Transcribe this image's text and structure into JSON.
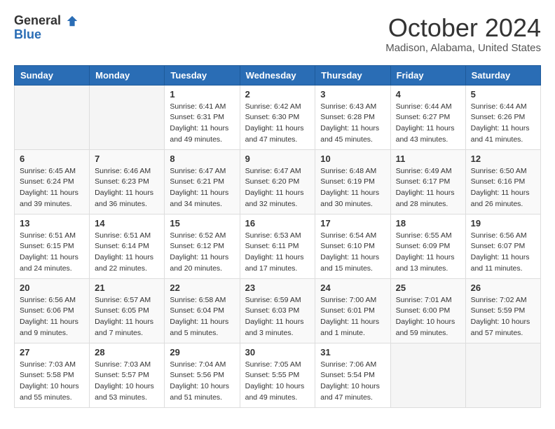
{
  "logo": {
    "general": "General",
    "blue": "Blue"
  },
  "title": "October 2024",
  "subtitle": "Madison, Alabama, United States",
  "days_of_week": [
    "Sunday",
    "Monday",
    "Tuesday",
    "Wednesday",
    "Thursday",
    "Friday",
    "Saturday"
  ],
  "weeks": [
    [
      {
        "day": "",
        "sunrise": "",
        "sunset": "",
        "daylight": ""
      },
      {
        "day": "",
        "sunrise": "",
        "sunset": "",
        "daylight": ""
      },
      {
        "day": "1",
        "sunrise": "Sunrise: 6:41 AM",
        "sunset": "Sunset: 6:31 PM",
        "daylight": "Daylight: 11 hours and 49 minutes."
      },
      {
        "day": "2",
        "sunrise": "Sunrise: 6:42 AM",
        "sunset": "Sunset: 6:30 PM",
        "daylight": "Daylight: 11 hours and 47 minutes."
      },
      {
        "day": "3",
        "sunrise": "Sunrise: 6:43 AM",
        "sunset": "Sunset: 6:28 PM",
        "daylight": "Daylight: 11 hours and 45 minutes."
      },
      {
        "day": "4",
        "sunrise": "Sunrise: 6:44 AM",
        "sunset": "Sunset: 6:27 PM",
        "daylight": "Daylight: 11 hours and 43 minutes."
      },
      {
        "day": "5",
        "sunrise": "Sunrise: 6:44 AM",
        "sunset": "Sunset: 6:26 PM",
        "daylight": "Daylight: 11 hours and 41 minutes."
      }
    ],
    [
      {
        "day": "6",
        "sunrise": "Sunrise: 6:45 AM",
        "sunset": "Sunset: 6:24 PM",
        "daylight": "Daylight: 11 hours and 39 minutes."
      },
      {
        "day": "7",
        "sunrise": "Sunrise: 6:46 AM",
        "sunset": "Sunset: 6:23 PM",
        "daylight": "Daylight: 11 hours and 36 minutes."
      },
      {
        "day": "8",
        "sunrise": "Sunrise: 6:47 AM",
        "sunset": "Sunset: 6:21 PM",
        "daylight": "Daylight: 11 hours and 34 minutes."
      },
      {
        "day": "9",
        "sunrise": "Sunrise: 6:47 AM",
        "sunset": "Sunset: 6:20 PM",
        "daylight": "Daylight: 11 hours and 32 minutes."
      },
      {
        "day": "10",
        "sunrise": "Sunrise: 6:48 AM",
        "sunset": "Sunset: 6:19 PM",
        "daylight": "Daylight: 11 hours and 30 minutes."
      },
      {
        "day": "11",
        "sunrise": "Sunrise: 6:49 AM",
        "sunset": "Sunset: 6:17 PM",
        "daylight": "Daylight: 11 hours and 28 minutes."
      },
      {
        "day": "12",
        "sunrise": "Sunrise: 6:50 AM",
        "sunset": "Sunset: 6:16 PM",
        "daylight": "Daylight: 11 hours and 26 minutes."
      }
    ],
    [
      {
        "day": "13",
        "sunrise": "Sunrise: 6:51 AM",
        "sunset": "Sunset: 6:15 PM",
        "daylight": "Daylight: 11 hours and 24 minutes."
      },
      {
        "day": "14",
        "sunrise": "Sunrise: 6:51 AM",
        "sunset": "Sunset: 6:14 PM",
        "daylight": "Daylight: 11 hours and 22 minutes."
      },
      {
        "day": "15",
        "sunrise": "Sunrise: 6:52 AM",
        "sunset": "Sunset: 6:12 PM",
        "daylight": "Daylight: 11 hours and 20 minutes."
      },
      {
        "day": "16",
        "sunrise": "Sunrise: 6:53 AM",
        "sunset": "Sunset: 6:11 PM",
        "daylight": "Daylight: 11 hours and 17 minutes."
      },
      {
        "day": "17",
        "sunrise": "Sunrise: 6:54 AM",
        "sunset": "Sunset: 6:10 PM",
        "daylight": "Daylight: 11 hours and 15 minutes."
      },
      {
        "day": "18",
        "sunrise": "Sunrise: 6:55 AM",
        "sunset": "Sunset: 6:09 PM",
        "daylight": "Daylight: 11 hours and 13 minutes."
      },
      {
        "day": "19",
        "sunrise": "Sunrise: 6:56 AM",
        "sunset": "Sunset: 6:07 PM",
        "daylight": "Daylight: 11 hours and 11 minutes."
      }
    ],
    [
      {
        "day": "20",
        "sunrise": "Sunrise: 6:56 AM",
        "sunset": "Sunset: 6:06 PM",
        "daylight": "Daylight: 11 hours and 9 minutes."
      },
      {
        "day": "21",
        "sunrise": "Sunrise: 6:57 AM",
        "sunset": "Sunset: 6:05 PM",
        "daylight": "Daylight: 11 hours and 7 minutes."
      },
      {
        "day": "22",
        "sunrise": "Sunrise: 6:58 AM",
        "sunset": "Sunset: 6:04 PM",
        "daylight": "Daylight: 11 hours and 5 minutes."
      },
      {
        "day": "23",
        "sunrise": "Sunrise: 6:59 AM",
        "sunset": "Sunset: 6:03 PM",
        "daylight": "Daylight: 11 hours and 3 minutes."
      },
      {
        "day": "24",
        "sunrise": "Sunrise: 7:00 AM",
        "sunset": "Sunset: 6:01 PM",
        "daylight": "Daylight: 11 hours and 1 minute."
      },
      {
        "day": "25",
        "sunrise": "Sunrise: 7:01 AM",
        "sunset": "Sunset: 6:00 PM",
        "daylight": "Daylight: 10 hours and 59 minutes."
      },
      {
        "day": "26",
        "sunrise": "Sunrise: 7:02 AM",
        "sunset": "Sunset: 5:59 PM",
        "daylight": "Daylight: 10 hours and 57 minutes."
      }
    ],
    [
      {
        "day": "27",
        "sunrise": "Sunrise: 7:03 AM",
        "sunset": "Sunset: 5:58 PM",
        "daylight": "Daylight: 10 hours and 55 minutes."
      },
      {
        "day": "28",
        "sunrise": "Sunrise: 7:03 AM",
        "sunset": "Sunset: 5:57 PM",
        "daylight": "Daylight: 10 hours and 53 minutes."
      },
      {
        "day": "29",
        "sunrise": "Sunrise: 7:04 AM",
        "sunset": "Sunset: 5:56 PM",
        "daylight": "Daylight: 10 hours and 51 minutes."
      },
      {
        "day": "30",
        "sunrise": "Sunrise: 7:05 AM",
        "sunset": "Sunset: 5:55 PM",
        "daylight": "Daylight: 10 hours and 49 minutes."
      },
      {
        "day": "31",
        "sunrise": "Sunrise: 7:06 AM",
        "sunset": "Sunset: 5:54 PM",
        "daylight": "Daylight: 10 hours and 47 minutes."
      },
      {
        "day": "",
        "sunrise": "",
        "sunset": "",
        "daylight": ""
      },
      {
        "day": "",
        "sunrise": "",
        "sunset": "",
        "daylight": ""
      }
    ]
  ]
}
